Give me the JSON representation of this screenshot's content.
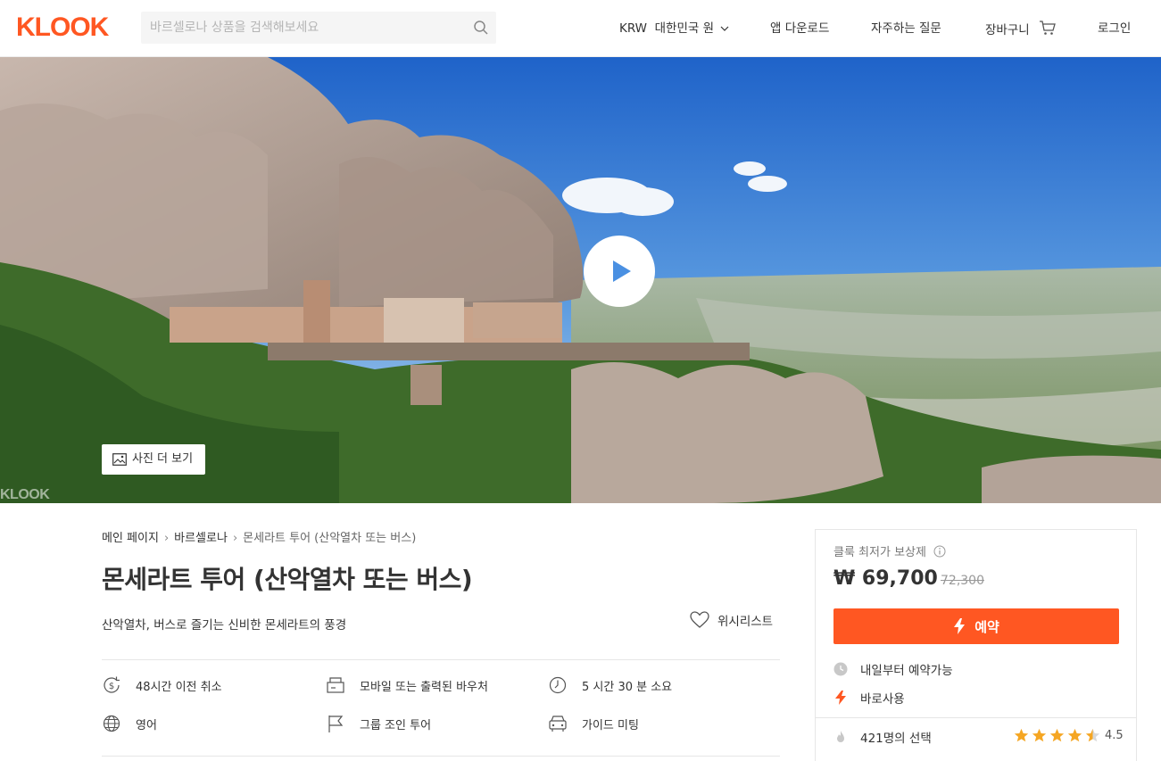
{
  "header": {
    "logo": "KLOOK",
    "search_placeholder": "바르셀로나 상품을 검색해보세요",
    "currency": "KRW",
    "language": "대한민국 원",
    "app_download": "앱 다운로드",
    "faq": "자주하는 질문",
    "cart": "장바구니",
    "login": "로그인"
  },
  "hero": {
    "more_photos": "사진 더 보기",
    "watermark": "KLOOK"
  },
  "breadcrumb": [
    "메인 페이지",
    "바르셀로나",
    "몬세라트 투어 (산악열차 또는 버스)"
  ],
  "product": {
    "title": "몬세라트 투어 (산악열차 또는 버스)",
    "subtitle": "산악열차, 버스로 즐기는 신비한 몬세라트의 풍경",
    "wishlist": "위시리스트"
  },
  "features": [
    {
      "icon": "dollar-refund-icon",
      "label": "48시간 이전 취소"
    },
    {
      "icon": "voucher-icon",
      "label": "모바일 또는 출력된 바우처"
    },
    {
      "icon": "clock-icon",
      "label": "5 시간 30 분 소요"
    },
    {
      "icon": "globe-icon",
      "label": "영어"
    },
    {
      "icon": "flag-icon",
      "label": "그룹 조인 투어"
    },
    {
      "icon": "vehicle-icon",
      "label": "가이드 미팅"
    }
  ],
  "booking": {
    "guarantee": "클룩 최저가 보상제",
    "price": "₩ 69,700",
    "original_price": "72,300",
    "book_label": "예약",
    "availability": "내일부터 예약가능",
    "instant": "바로사용",
    "booked_count": "421명의 선택",
    "rating": 4.5,
    "rating_label": "4.5"
  },
  "colors": {
    "brand": "#ff5722",
    "star": "#f5a623",
    "play": "#4a90e2"
  }
}
